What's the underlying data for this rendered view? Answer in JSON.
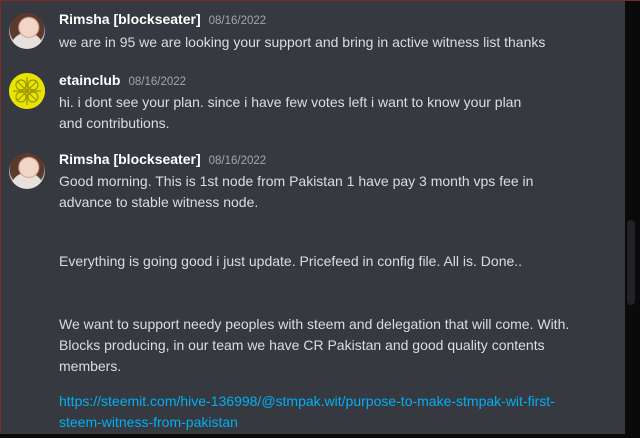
{
  "messages": [
    {
      "author": "Rimsha [blockseater]",
      "timestamp": "08/16/2022",
      "avatar": "rimsha-avatar",
      "paragraphs": [
        "we are in 95 we are looking your support and bring in active witness list thanks"
      ]
    },
    {
      "author": "etainclub",
      "timestamp": "08/16/2022",
      "avatar": "etainclub-avatar",
      "paragraphs": [
        "hi. i dont see your plan. since i have few votes left i want to know your plan and contributions."
      ]
    },
    {
      "author": "Rimsha [blockseater]",
      "timestamp": "08/16/2022",
      "avatar": "rimsha-avatar",
      "paragraphs": [
        "Good morning. This is 1st node from Pakistan 1 have pay 3 month vps fee in advance to stable witness node.",
        "Everything is going good i just update.  Pricefeed in config file. All is. Done..",
        "We want to support needy peoples with steem and delegation that will come. With. Blocks producing, in our team we have CR Pakistan and good quality contents members."
      ],
      "link": "https://steemit.com/hive-136998/@stmpak.wit/purpose-to-make-stmpak-wit-first-steem-witness-from-pakistan"
    }
  ],
  "colors": {
    "background": "#36393f",
    "username": "#ffffff",
    "timestamp": "#a3a6aa",
    "text": "#dcddde",
    "link": "#00b0f4"
  }
}
